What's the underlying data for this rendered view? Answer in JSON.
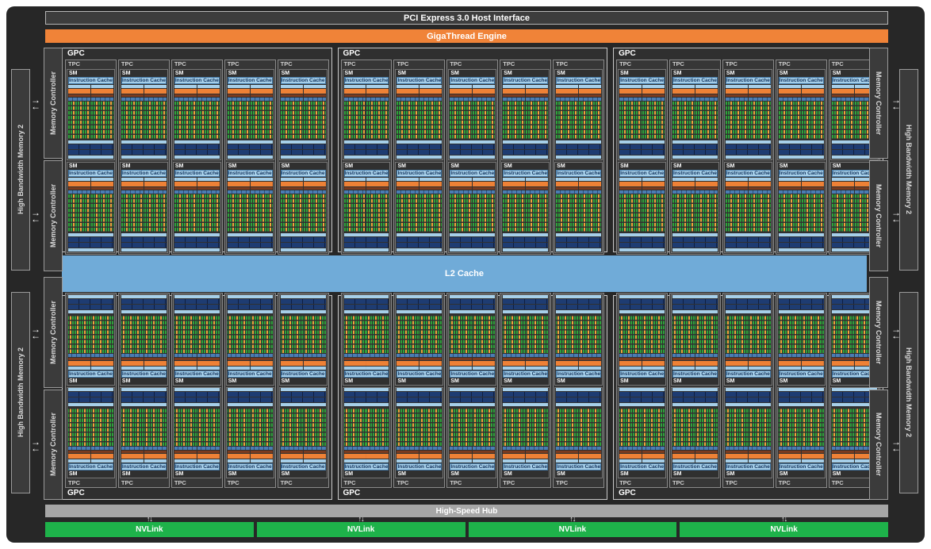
{
  "labels": {
    "pcie": "PCI Express 3.0 Host Interface",
    "gigathread": "GigaThread Engine",
    "gpc": "GPC",
    "tpc": "TPC",
    "sm": "SM",
    "instruction_cache": "Instruction Cache",
    "l2": "L2 Cache",
    "hub": "High-Speed Hub",
    "nvlink": "NVLink",
    "memory_controller": "Memory Controller",
    "hbm2": "High Bandwidth Memory 2"
  },
  "icons": {
    "bidirectional_arrow": {
      "up": "→",
      "down": "←"
    },
    "updown_arrow": "↑↓"
  },
  "layout_counts": {
    "gpc_rows": 2,
    "gpcs_per_row": 3,
    "tpcs_per_gpc": 5,
    "sms_per_tpc": 2,
    "nvlink_blocks": 4,
    "memory_controllers_per_side": 4,
    "hbm_stacks_per_side": 2
  },
  "colors": {
    "chip_background": "#272727",
    "host_interface_bar": "#3d3d3d",
    "gigathread_orange": "#f08338",
    "l2_blue": "#70abd8",
    "instruction_cache_blue": "#a6cfe9",
    "warp_scheduler_orange": "#ee8136",
    "dispatch_red": "#7a3b1f",
    "register_file_blue": "#4a7db3",
    "tex_unit_navy": "#1e3c72",
    "core_green": "#2ea33b",
    "core_yellow": "#eda73b",
    "nvlink_green": "#1eb24a",
    "hub_gray": "#a6a6a6"
  }
}
